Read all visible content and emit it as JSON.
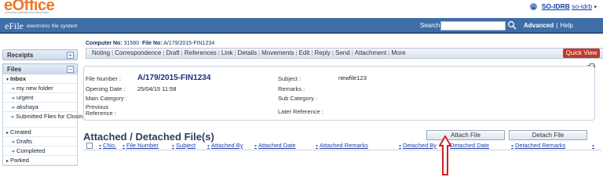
{
  "brand": {
    "logo": "eOffice",
    "tagline": "A DIGITAL WORKPLACE SOLUTION"
  },
  "user": {
    "name": "SO-IDRB",
    "login": "so-idrb",
    "caret": "▾"
  },
  "header": {
    "title": "eFile",
    "subtitle": "electronic file system",
    "search_label": "Search",
    "search_value": "",
    "advanced": "Advanced",
    "separator": "|",
    "help": "Help"
  },
  "sidebar": {
    "receipts": {
      "label": "Receipts",
      "toggle": "+"
    },
    "files": {
      "label": "Files",
      "toggle": "−"
    },
    "items": [
      {
        "label": "Inbox",
        "kind": "top"
      },
      {
        "label": "my new folder",
        "kind": "sub"
      },
      {
        "label": "urgent",
        "kind": "sub"
      },
      {
        "label": "akshaya",
        "kind": "sub"
      },
      {
        "label": "Submitted Files for Closing Approval",
        "kind": "sub"
      },
      {
        "label": "Created",
        "kind": "top"
      },
      {
        "label": "Drafts",
        "kind": "sub"
      },
      {
        "label": "Completed",
        "kind": "sub"
      },
      {
        "label": "Parked",
        "kind": "top"
      }
    ]
  },
  "file_info": {
    "computer_no_label": "Computer No:",
    "computer_no": "31580",
    "file_no_label": "File No:",
    "file_no": "A/179/2015-FIN1234"
  },
  "tabs": [
    "Noting",
    "Correspondence",
    "Draft",
    "References",
    "Link",
    "Details",
    "Movements",
    "Edit",
    "Reply",
    "Send",
    "Attachment",
    "More"
  ],
  "quick_view": "Quick View",
  "details": {
    "file_number_label": "File Number :",
    "file_number": "A/179/2015-FIN1234",
    "opening_date_label": "Opening Date :",
    "opening_date": "25/04/15 11:58",
    "main_category_label": "Main Category :",
    "previous_reference_label": "Previous Reference :",
    "subject_label": "Subject :",
    "subject": "newfile123",
    "remarks_label": "Remarks :",
    "sub_category_label": "Sub Category :",
    "later_reference_label": "Later Reference :"
  },
  "attached": {
    "title": "Attached / Detached File(s)",
    "attach_button": "Attach File",
    "detach_button": "Detach File",
    "columns": [
      "CNo.",
      "File Number",
      "Subject",
      "Attached By",
      "Attached Date",
      "Attached Remarks",
      "Detached By",
      "Detached Date",
      "Detached Remarks"
    ]
  },
  "colors": {
    "header_blue": "#3e6ea8",
    "quick_view_red": "#c0392b",
    "pointer_red": "#d42020",
    "link_blue": "#1d3fa8"
  }
}
